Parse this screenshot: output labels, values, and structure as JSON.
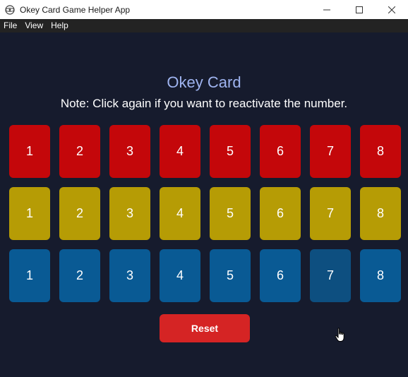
{
  "window": {
    "title": "Okey Card Game Helper App"
  },
  "menu": [
    "File",
    "View",
    "Help"
  ],
  "heading": "Okey Card",
  "note": "Note: Click again if you want to reactivate the number.",
  "rows": [
    {
      "color": "red",
      "hex": "#c4070a",
      "numbers": [
        "1",
        "2",
        "3",
        "4",
        "5",
        "6",
        "7",
        "8"
      ]
    },
    {
      "color": "yellow",
      "hex": "#b69c05",
      "numbers": [
        "1",
        "2",
        "3",
        "4",
        "5",
        "6",
        "7",
        "8"
      ]
    },
    {
      "color": "blue",
      "hex": "#095a94",
      "numbers": [
        "1",
        "2",
        "3",
        "4",
        "5",
        "6",
        "7",
        "8"
      ]
    }
  ],
  "reset_label": "Reset",
  "colors": {
    "background": "#161b2d",
    "heading": "#9fb4f0",
    "reset": "#d52424"
  }
}
